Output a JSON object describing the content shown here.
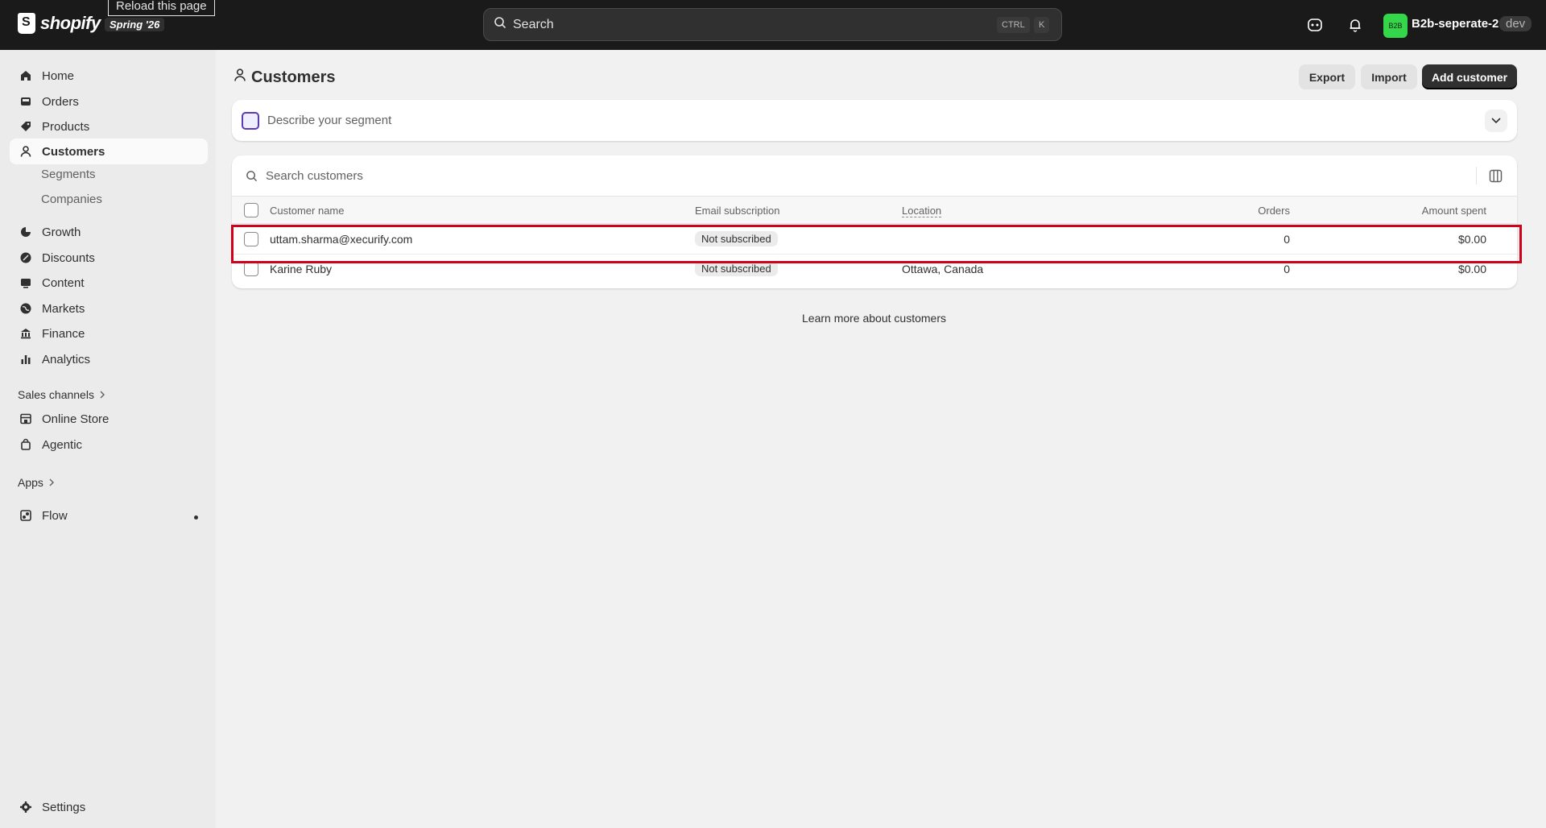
{
  "tooltip": "Reload this page",
  "brand": {
    "name": "shopify",
    "release_badge": "Spring '26"
  },
  "search": {
    "placeholder": "Search",
    "shortcut_modifier": "CTRL",
    "shortcut_key": "K"
  },
  "store": {
    "badge": "B2B",
    "name": "B2b-seperate-2",
    "env": "dev"
  },
  "sidebar": {
    "items": [
      {
        "label": "Home",
        "icon": "home-icon"
      },
      {
        "label": "Orders",
        "icon": "inbox-icon"
      },
      {
        "label": "Products",
        "icon": "tag-icon"
      },
      {
        "label": "Customers",
        "icon": "person-icon",
        "active": true
      },
      {
        "label": "Growth",
        "icon": "growth-icon"
      },
      {
        "label": "Discounts",
        "icon": "discount-icon"
      },
      {
        "label": "Content",
        "icon": "content-icon"
      },
      {
        "label": "Markets",
        "icon": "globe-icon"
      },
      {
        "label": "Finance",
        "icon": "bank-icon"
      },
      {
        "label": "Analytics",
        "icon": "bar-chart-icon"
      },
      {
        "label": "Online Store",
        "icon": "store-icon"
      },
      {
        "label": "Agentic",
        "icon": "bag-icon"
      },
      {
        "label": "Flow",
        "icon": "flow-icon"
      },
      {
        "label": "Settings",
        "icon": "gear-icon"
      }
    ],
    "sub_items": [
      "Segments",
      "Companies"
    ],
    "sections": [
      "Sales channels",
      "Apps"
    ]
  },
  "page": {
    "title": "Customers",
    "export_label": "Export",
    "import_label": "Import",
    "add_label": "Add customer",
    "segment_placeholder": "Describe your segment",
    "table_search_placeholder": "Search customers",
    "learn_more": "Learn more about customers"
  },
  "table": {
    "columns": [
      "Customer name",
      "Email subscription",
      "Location",
      "Orders",
      "Amount spent"
    ],
    "rows": [
      {
        "name": "uttam.sharma@xecurify.com",
        "subscription": "Not subscribed",
        "location": "",
        "orders": "0",
        "amount": "$0.00"
      },
      {
        "name": "Karine Ruby",
        "subscription": "Not subscribed",
        "location": "Ottawa, Canada",
        "orders": "0",
        "amount": "$0.00"
      }
    ]
  },
  "colors": {
    "topbar": "#1a1a1a",
    "store_badge": "#34d74a",
    "highlight": "#d0021b",
    "primary_button": "#303030"
  }
}
